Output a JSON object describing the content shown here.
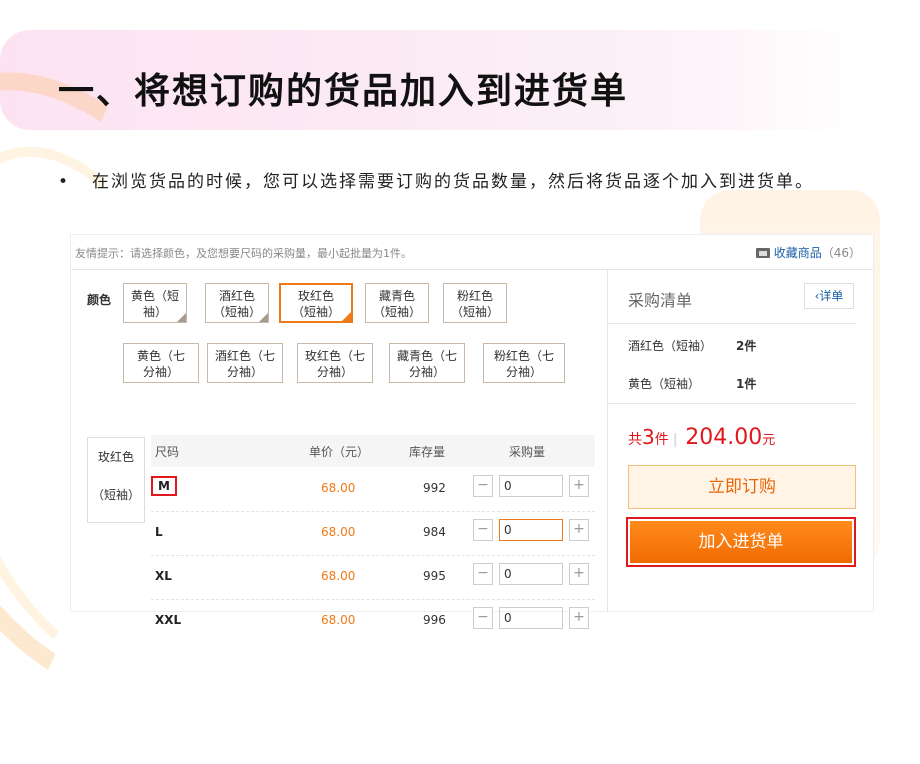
{
  "slide": {
    "title": "一、将想订购的货品加入到进货单",
    "bullet": {
      "dot": "•",
      "text": "在浏览货品的时候，您可以选择需要订购的货品数量，然后将货品逐个加入到进货单。"
    }
  },
  "panel": {
    "tip": "友情提示：请选择颜色，及您想要尺码的采购量，最小起批量为1件。",
    "favorite": {
      "label": "收藏商品",
      "count": "（46）",
      "icon": "folder-icon"
    },
    "color_label": "颜色",
    "colors_row1": [
      {
        "line1": "黄色（短",
        "line2": "袖）"
      },
      {
        "line1": "酒红色",
        "line2": "（短袖）"
      },
      {
        "line1": "玫红色",
        "line2": "（短袖）"
      },
      {
        "line1": "藏青色",
        "line2": "（短袖）"
      },
      {
        "line1": "粉红色",
        "line2": "（短袖）"
      }
    ],
    "colors_row2": [
      {
        "line1": "黄色（七",
        "line2": "分袖）"
      },
      {
        "line1": "酒红色（七",
        "line2": "分袖）"
      },
      {
        "line1": "玫红色（七",
        "line2": "分袖）"
      },
      {
        "line1": "藏青色（七",
        "line2": "分袖）"
      },
      {
        "line1": "粉红色（七",
        "line2": "分袖）"
      }
    ],
    "selected_color": {
      "line1": "玫红色",
      "line2": "（短袖）"
    },
    "size_table": {
      "headers": {
        "size": "尺码",
        "price": "单价（元）",
        "stock": "库存量",
        "qty": "采购量"
      },
      "rows": [
        {
          "size": "M",
          "price": "68.00",
          "stock": "992",
          "qty": "0"
        },
        {
          "size": "L",
          "price": "68.00",
          "stock": "984",
          "qty": "0"
        },
        {
          "size": "XL",
          "price": "68.00",
          "stock": "995",
          "qty": "0"
        },
        {
          "size": "XXL",
          "price": "68.00",
          "stock": "996",
          "qty": "0"
        }
      ],
      "minus": "−",
      "plus": "+"
    },
    "cart": {
      "title": "采购清单",
      "detail_button": "‹详单",
      "items": [
        {
          "name": "酒红色（短袖）",
          "qty": "2件"
        },
        {
          "name": "黄色（短袖）",
          "qty": "1件"
        }
      ],
      "total_prefix": "共",
      "total_count": "3",
      "total_unit": "件",
      "total_sep": "|",
      "total_amount": "204.00",
      "currency": "元",
      "order_button": "立即订购",
      "add_button": "加入进货单"
    }
  },
  "colors": {
    "accent_orange": "#f07a1a",
    "highlight_red": "#e0181c",
    "link_blue": "#1a5ea8"
  }
}
